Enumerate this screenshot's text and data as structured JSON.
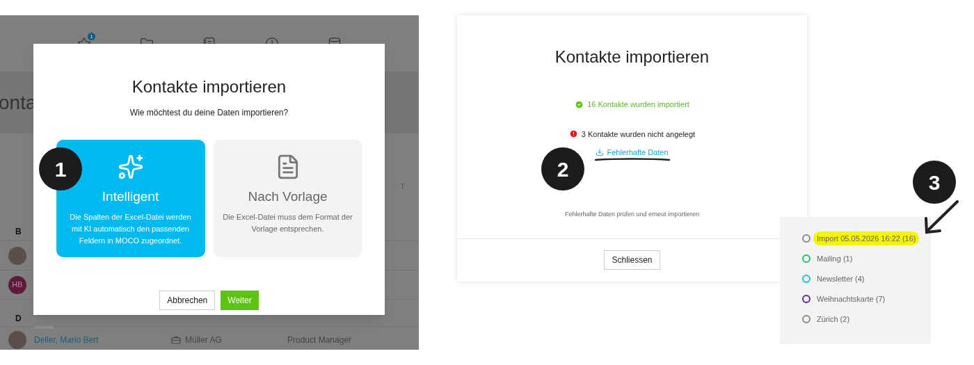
{
  "background_app": {
    "nav_icons": [
      {
        "kind": "star",
        "badge": "1"
      },
      {
        "kind": "folder"
      },
      {
        "kind": "calendar"
      },
      {
        "kind": "clock"
      },
      {
        "kind": "database"
      }
    ],
    "heading": "onta",
    "column_letters": [
      "T"
    ],
    "sections": [
      {
        "letter": "B",
        "rows": [
          {
            "kind": "photo"
          },
          {
            "kind": "initials",
            "initials": "HB"
          }
        ]
      },
      {
        "letter": "D",
        "rows": [
          {
            "kind": "photo",
            "name": "Deller, Mario Bert",
            "company": "Müller AG",
            "position": "Product Manager"
          }
        ]
      }
    ]
  },
  "import_dialog": {
    "title": "Kontakte importieren",
    "subtitle": "Wie möchtest du deine Daten importieren?",
    "options": [
      {
        "kind": "ai",
        "title": "Intelligent",
        "description": "Die Spalten der Excel-Datei werden mit KI automatisch den passenden Feldern in MOCO zugeordnet.",
        "selected": true
      },
      {
        "kind": "template",
        "title": "Nach Vorlage",
        "description": "Die Excel-Datei muss dem Format der Vorlage entsprechen.",
        "selected": false
      }
    ],
    "buttons": [
      {
        "label": "Abbrechen",
        "kind": "secondary"
      },
      {
        "label": "Weiter",
        "kind": "primary"
      }
    ]
  },
  "result_dialog": {
    "title": "Kontakte importieren",
    "success": "16 Kontakte wurden importiert",
    "error": "3 Kontakte wurden nicht angelegt",
    "link": "Fehlerhafte Daten",
    "hint": "Fehlerhafte Daten prüfen und erneut importieren",
    "button": "Schliessen"
  },
  "tag_list": {
    "tags": [
      {
        "label": "Import 05.05.2026 16:22 (16)",
        "color": "#8a8a8a",
        "highlighted": true
      },
      {
        "label": "Mailing (1)",
        "color": "#1fbf73",
        "highlighted": false
      },
      {
        "label": "Newsletter (4)",
        "color": "#22bfe0",
        "highlighted": false
      },
      {
        "label": "Weihnachtskarte (7)",
        "color": "#5b2ca0",
        "highlighted": false
      },
      {
        "label": "Zürich (2)",
        "color": "#8a8a8a",
        "highlighted": false
      }
    ]
  },
  "callouts": [
    "1",
    "2",
    "3"
  ]
}
